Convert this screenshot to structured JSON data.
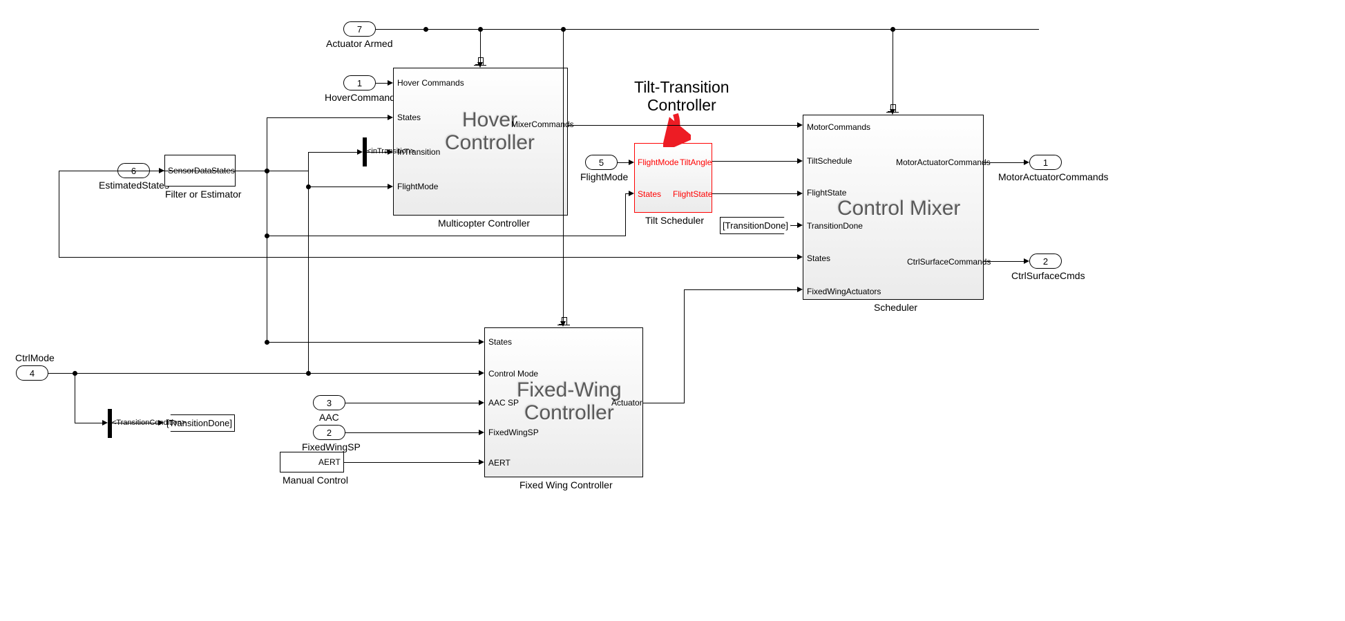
{
  "inports": {
    "p1": {
      "num": "1",
      "label": "HoverCommands"
    },
    "p2": {
      "num": "2",
      "label": "FixedWingSP"
    },
    "p3": {
      "num": "3",
      "label": "AAC"
    },
    "p4": {
      "num": "4",
      "label": "CtrlMode"
    },
    "p5": {
      "num": "5",
      "label": "FlightMode"
    },
    "p6": {
      "num": "6",
      "label": "EstimatedStates"
    },
    "p7": {
      "num": "7",
      "label": "Actuator Armed"
    }
  },
  "outports": {
    "o1": {
      "num": "1",
      "label": "MotorActuatorCommands"
    },
    "o2": {
      "num": "2",
      "label": "CtrlSurfaceCmds"
    }
  },
  "blocks": {
    "filter": {
      "title": "Filter or Estimator",
      "in": "SensorData",
      "out": "States"
    },
    "hover": {
      "title": "Multicopter Controller",
      "big": "Hover\nController",
      "in1": "Hover Commands",
      "in2": "States",
      "in3": "InTransition",
      "in4": "FlightMode",
      "out1": "MixerCommands"
    },
    "tilt": {
      "title": "Tilt Scheduler",
      "in1": "FlightMode",
      "in2": "States",
      "out1": "TiltAngle",
      "out2": "FlightState"
    },
    "fw": {
      "title": "Fixed Wing Controller",
      "big": "Fixed-Wing\nController",
      "in1": "States",
      "in2": "Control Mode",
      "in3": "AAC SP",
      "in4": "FixedWingSP",
      "in5": "AERT",
      "out1": "Actuator"
    },
    "mixer": {
      "title": "Scheduler",
      "big": "Control Mixer",
      "in1": "MotorCommands",
      "in2": "TiltSchedule",
      "in3": "FlightState",
      "in4": "TransitionDone",
      "in5": "States",
      "in6": "FixedWingActuators",
      "out1": "MotorActuatorCommands",
      "out2": "CtrlSurfaceCommands"
    },
    "manual": {
      "title": "Manual Control",
      "out": "AERT"
    }
  },
  "tags": {
    "goto": "[TransitionDone]",
    "from": "[TransitionDone]"
  },
  "busLabels": {
    "inTransition": "<inTransition>",
    "transCond": "<TransitionCondition>"
  },
  "annotation": {
    "tilt": "Tilt-Transition\nController"
  }
}
